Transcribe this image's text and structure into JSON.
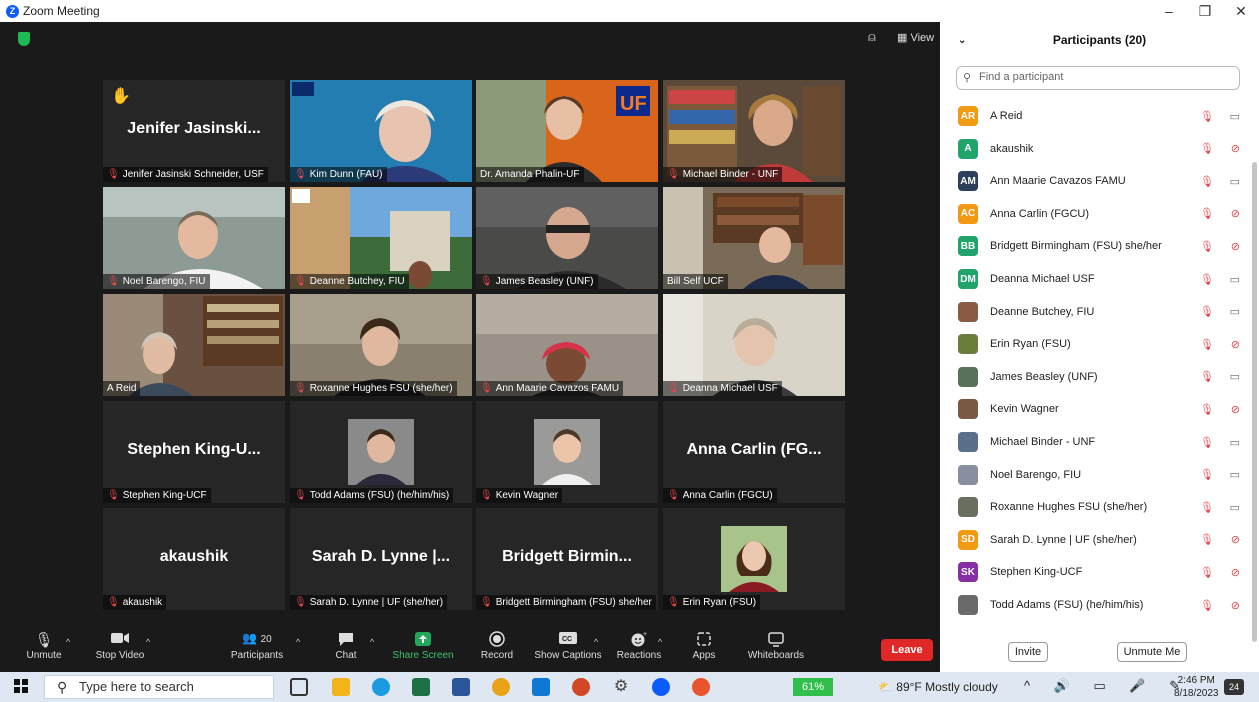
{
  "window": {
    "title": "Zoom Meeting",
    "minimize": "–",
    "restore": "❐",
    "close": "✕"
  },
  "topbar": {
    "view_label": "View"
  },
  "tiles": [
    {
      "name": "Jenifer Jasinski Schneider, USF",
      "big": "Jenifer  Jasinski...",
      "raised_hand": "✋"
    },
    {
      "name": "Kim Dunn (FAU)"
    },
    {
      "name": "Dr. Amanda Phalin-UF"
    },
    {
      "name": "Michael Binder - UNF"
    },
    {
      "name": "Noel Barengo, FIU"
    },
    {
      "name": "Deanne Butchey, FIU"
    },
    {
      "name": "James Beasley (UNF)"
    },
    {
      "name": "Bill Self UCF"
    },
    {
      "name": "A Reid"
    },
    {
      "name": "Roxanne Hughes FSU (she/her)"
    },
    {
      "name": "Ann Maarie Cavazos FAMU"
    },
    {
      "name": "Deanna Michael USF"
    },
    {
      "name": "Stephen King-UCF",
      "big": "Stephen  King-U..."
    },
    {
      "name": "Todd Adams (FSU) (he/him/his)"
    },
    {
      "name": "Kevin Wagner"
    },
    {
      "name": "Anna Carlin (FGCU)",
      "big": "Anna  Carlin  (FG..."
    },
    {
      "name": "akaushik",
      "big": "akaushik"
    },
    {
      "name": "Sarah D. Lynne | UF (she/her)",
      "big": "Sarah  D.  Lynne  |..."
    },
    {
      "name": "Bridgett Birmingham (FSU) she/her",
      "big": "Bridgett  Birmin..."
    },
    {
      "name": "Erin Ryan (FSU)"
    }
  ],
  "toolbar": {
    "unmute": "Unmute",
    "stop_video": "Stop Video",
    "participants": "Participants",
    "participants_count": "20",
    "chat": "Chat",
    "share_screen": "Share Screen",
    "record": "Record",
    "show_captions": "Show Captions",
    "reactions": "Reactions",
    "apps": "Apps",
    "whiteboards": "Whiteboards",
    "leave": "Leave"
  },
  "panel": {
    "title": "Participants (20)",
    "search_placeholder": "Find a participant",
    "invite": "Invite",
    "unmute_me": "Unmute Me",
    "participants": [
      {
        "initials": "AR",
        "name": "A Reid",
        "color": "#f29a13",
        "video": "off-cam"
      },
      {
        "initials": "A",
        "name": "akaushik",
        "color": "#20a46b",
        "video": "video-off"
      },
      {
        "initials": "AM",
        "name": "Ann Maarie Cavazos FAMU",
        "color": "#2d3e5a",
        "video": "off-cam"
      },
      {
        "initials": "AC",
        "name": "Anna Carlin (FGCU)",
        "color": "#f29a13",
        "video": "video-off"
      },
      {
        "initials": "BB",
        "name": "Bridgett Birmingham (FSU) she/her",
        "color": "#20a46b",
        "video": "video-off"
      },
      {
        "initials": "DM",
        "name": "Deanna Michael USF",
        "color": "#20a46b",
        "video": "off-cam"
      },
      {
        "initials": "",
        "name": "Deanne Butchey, FIU",
        "color": "#8a5a44",
        "video": "off-cam"
      },
      {
        "initials": "",
        "name": "Erin Ryan (FSU)",
        "color": "#6b7d3a",
        "video": "video-off"
      },
      {
        "initials": "",
        "name": "James Beasley (UNF)",
        "color": "#59705a",
        "video": "off-cam"
      },
      {
        "initials": "",
        "name": "Kevin Wagner",
        "color": "#7a5a44",
        "video": "video-off"
      },
      {
        "initials": "",
        "name": "Michael Binder - UNF",
        "color": "#5a6f8a",
        "video": "off-cam"
      },
      {
        "initials": "",
        "name": "Noel Barengo, FIU",
        "color": "#8a8fa0",
        "video": "off-cam"
      },
      {
        "initials": "",
        "name": "Roxanne Hughes FSU (she/her)",
        "color": "#6a7060",
        "video": "off-cam"
      },
      {
        "initials": "SD",
        "name": "Sarah D. Lynne | UF (she/her)",
        "color": "#f29a13",
        "video": "video-off"
      },
      {
        "initials": "SK",
        "name": "Stephen King-UCF",
        "color": "#8a2ea8",
        "video": "video-off"
      },
      {
        "initials": "",
        "name": "Todd Adams (FSU) (he/him/his)",
        "color": "#6a6a6a",
        "video": "video-off"
      }
    ]
  },
  "taskbar": {
    "search_placeholder": "Type here to search",
    "battery": "61%",
    "weather": "89°F  Mostly cloudy",
    "time": "2:46 PM",
    "date": "8/18/2023",
    "notifications": "24"
  }
}
